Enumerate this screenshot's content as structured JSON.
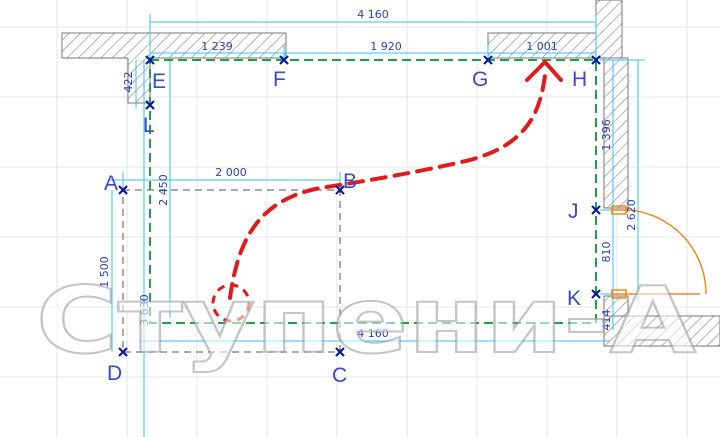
{
  "points": [
    {
      "id": "A",
      "label": "A"
    },
    {
      "id": "B",
      "label": "B"
    },
    {
      "id": "C",
      "label": "C"
    },
    {
      "id": "D",
      "label": "D"
    },
    {
      "id": "E",
      "label": "E"
    },
    {
      "id": "F",
      "label": "F"
    },
    {
      "id": "G",
      "label": "G"
    },
    {
      "id": "H",
      "label": "H"
    },
    {
      "id": "J",
      "label": "J"
    },
    {
      "id": "K",
      "label": "K"
    },
    {
      "id": "L",
      "label": "L"
    }
  ],
  "dimensions": {
    "top_total": "4 160",
    "top_e_f": "1 239",
    "top_f_g": "1 920",
    "top_g_h": "1 001",
    "a_b": "2 000",
    "bottom_total": "4 160",
    "left_e_l": "422",
    "inner_2450": "2 450",
    "left_a_d": "1 500",
    "left_3830": "3 830",
    "right_h_j": "1 396",
    "right_j_k": "810",
    "right_k_bottom": "414",
    "right_2620": "2 620"
  },
  "watermark": "Ступени-А",
  "colors": {
    "dimension": "#33c3f0",
    "outline": "#1aa34a",
    "path": "#e01b1b",
    "door": "#f08a1c",
    "label": "#3a49c9"
  }
}
